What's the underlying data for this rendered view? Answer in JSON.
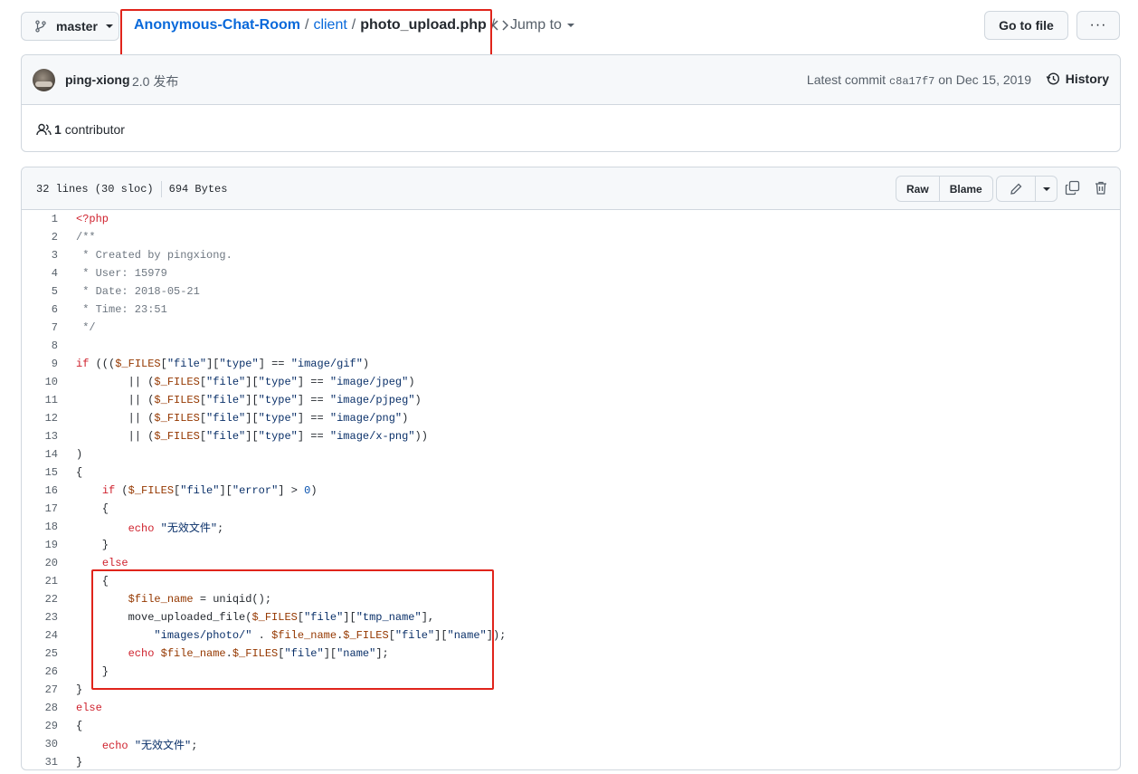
{
  "branch": {
    "name": "master"
  },
  "breadcrumb": {
    "repo": "Anonymous-Chat-Room",
    "sep1": "/",
    "dir": "client",
    "sep2": "/",
    "file": "photo_upload.php",
    "sep3": "/"
  },
  "jump": {
    "label": "Jump to"
  },
  "actions": {
    "goto_file": "Go to file",
    "more": "···"
  },
  "commit": {
    "author": "ping-xiong",
    "message": "2.0 发布",
    "latest_prefix": "Latest commit",
    "sha": "c8a17f7",
    "date": "on Dec 15, 2019",
    "history_label": "History"
  },
  "contributors": {
    "count": "1",
    "label": "contributor"
  },
  "file": {
    "lines_info": "32 lines (30 sloc)",
    "size_info": "694 Bytes",
    "raw_label": "Raw",
    "blame_label": "Blame"
  },
  "highlight_color": "#e0241b",
  "code_lines": [
    {
      "n": "1",
      "tokens": [
        [
          "k",
          "<?php"
        ]
      ]
    },
    {
      "n": "2",
      "tokens": [
        [
          "c",
          "/**"
        ]
      ]
    },
    {
      "n": "3",
      "tokens": [
        [
          "c",
          " * Created by pingxiong."
        ]
      ]
    },
    {
      "n": "4",
      "tokens": [
        [
          "c",
          " * User: 15979"
        ]
      ]
    },
    {
      "n": "5",
      "tokens": [
        [
          "c",
          " * Date: 2018-05-21"
        ]
      ]
    },
    {
      "n": "6",
      "tokens": [
        [
          "c",
          " * Time: 23:51"
        ]
      ]
    },
    {
      "n": "7",
      "tokens": [
        [
          "c",
          " */"
        ]
      ]
    },
    {
      "n": "8",
      "tokens": []
    },
    {
      "n": "9",
      "tokens": [
        [
          "k",
          "if"
        ],
        [
          "p",
          " ((("
        ],
        [
          "v",
          "$_FILES"
        ],
        [
          "p",
          "["
        ],
        [
          "s",
          "\"file\""
        ],
        [
          "p",
          "]["
        ],
        [
          "s",
          "\"type\""
        ],
        [
          "p",
          "] == "
        ],
        [
          "s",
          "\"image/gif\""
        ],
        [
          "p",
          ")"
        ]
      ]
    },
    {
      "n": "10",
      "tokens": [
        [
          "p",
          "        || ("
        ],
        [
          "v",
          "$_FILES"
        ],
        [
          "p",
          "["
        ],
        [
          "s",
          "\"file\""
        ],
        [
          "p",
          "]["
        ],
        [
          "s",
          "\"type\""
        ],
        [
          "p",
          "] == "
        ],
        [
          "s",
          "\"image/jpeg\""
        ],
        [
          "p",
          ")"
        ]
      ]
    },
    {
      "n": "11",
      "tokens": [
        [
          "p",
          "        || ("
        ],
        [
          "v",
          "$_FILES"
        ],
        [
          "p",
          "["
        ],
        [
          "s",
          "\"file\""
        ],
        [
          "p",
          "]["
        ],
        [
          "s",
          "\"type\""
        ],
        [
          "p",
          "] == "
        ],
        [
          "s",
          "\"image/pjpeg\""
        ],
        [
          "p",
          ")"
        ]
      ]
    },
    {
      "n": "12",
      "tokens": [
        [
          "p",
          "        || ("
        ],
        [
          "v",
          "$_FILES"
        ],
        [
          "p",
          "["
        ],
        [
          "s",
          "\"file\""
        ],
        [
          "p",
          "]["
        ],
        [
          "s",
          "\"type\""
        ],
        [
          "p",
          "] == "
        ],
        [
          "s",
          "\"image/png\""
        ],
        [
          "p",
          ")"
        ]
      ]
    },
    {
      "n": "13",
      "tokens": [
        [
          "p",
          "        || ("
        ],
        [
          "v",
          "$_FILES"
        ],
        [
          "p",
          "["
        ],
        [
          "s",
          "\"file\""
        ],
        [
          "p",
          "]["
        ],
        [
          "s",
          "\"type\""
        ],
        [
          "p",
          "] == "
        ],
        [
          "s",
          "\"image/x-png\""
        ],
        [
          "p",
          "))"
        ]
      ]
    },
    {
      "n": "14",
      "tokens": [
        [
          "p",
          ")"
        ]
      ]
    },
    {
      "n": "15",
      "tokens": [
        [
          "p",
          "{"
        ]
      ]
    },
    {
      "n": "16",
      "tokens": [
        [
          "p",
          "    "
        ],
        [
          "k",
          "if"
        ],
        [
          "p",
          " ("
        ],
        [
          "v",
          "$_FILES"
        ],
        [
          "p",
          "["
        ],
        [
          "s",
          "\"file\""
        ],
        [
          "p",
          "]["
        ],
        [
          "s",
          "\"error\""
        ],
        [
          "p",
          "] > "
        ],
        [
          "n",
          "0"
        ],
        [
          "p",
          ")"
        ]
      ]
    },
    {
      "n": "17",
      "tokens": [
        [
          "p",
          "    {"
        ]
      ]
    },
    {
      "n": "18",
      "tokens": [
        [
          "p",
          "        "
        ],
        [
          "k",
          "echo"
        ],
        [
          "p",
          " "
        ],
        [
          "s",
          "\"无效文件\""
        ],
        [
          "p",
          ";"
        ]
      ]
    },
    {
      "n": "19",
      "tokens": [
        [
          "p",
          "    }"
        ]
      ]
    },
    {
      "n": "20",
      "tokens": [
        [
          "p",
          "    "
        ],
        [
          "k",
          "else"
        ]
      ]
    },
    {
      "n": "21",
      "tokens": [
        [
          "p",
          "    {"
        ]
      ]
    },
    {
      "n": "22",
      "tokens": [
        [
          "p",
          "        "
        ],
        [
          "v",
          "$file_name"
        ],
        [
          "p",
          " = uniqid();"
        ]
      ]
    },
    {
      "n": "23",
      "tokens": [
        [
          "p",
          "        move_uploaded_file("
        ],
        [
          "v",
          "$_FILES"
        ],
        [
          "p",
          "["
        ],
        [
          "s",
          "\"file\""
        ],
        [
          "p",
          "]["
        ],
        [
          "s",
          "\"tmp_name\""
        ],
        [
          "p",
          "],"
        ]
      ]
    },
    {
      "n": "24",
      "tokens": [
        [
          "p",
          "            "
        ],
        [
          "s",
          "\"images/photo/\""
        ],
        [
          "p",
          " . "
        ],
        [
          "v",
          "$file_name"
        ],
        [
          "p",
          "."
        ],
        [
          "v",
          "$_FILES"
        ],
        [
          "p",
          "["
        ],
        [
          "s",
          "\"file\""
        ],
        [
          "p",
          "]["
        ],
        [
          "s",
          "\"name\""
        ],
        [
          "p",
          "]);"
        ]
      ]
    },
    {
      "n": "25",
      "tokens": [
        [
          "p",
          "        "
        ],
        [
          "k",
          "echo"
        ],
        [
          "p",
          " "
        ],
        [
          "v",
          "$file_name"
        ],
        [
          "p",
          "."
        ],
        [
          "v",
          "$_FILES"
        ],
        [
          "p",
          "["
        ],
        [
          "s",
          "\"file\""
        ],
        [
          "p",
          "]["
        ],
        [
          "s",
          "\"name\""
        ],
        [
          "p",
          "];"
        ]
      ]
    },
    {
      "n": "26",
      "tokens": [
        [
          "p",
          "    }"
        ]
      ]
    },
    {
      "n": "27",
      "tokens": [
        [
          "p",
          "}"
        ]
      ]
    },
    {
      "n": "28",
      "tokens": [
        [
          "k",
          "else"
        ]
      ]
    },
    {
      "n": "29",
      "tokens": [
        [
          "p",
          "{"
        ]
      ]
    },
    {
      "n": "30",
      "tokens": [
        [
          "p",
          "    "
        ],
        [
          "k",
          "echo"
        ],
        [
          "p",
          " "
        ],
        [
          "s",
          "\"无效文件\""
        ],
        [
          "p",
          ";"
        ]
      ]
    },
    {
      "n": "31",
      "tokens": [
        [
          "p",
          "}"
        ]
      ]
    }
  ]
}
